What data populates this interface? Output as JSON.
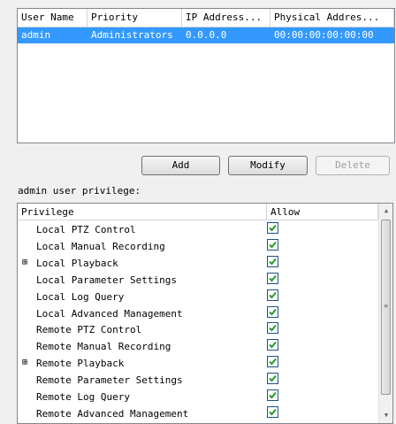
{
  "users_table": {
    "columns": [
      "User Name",
      "Priority",
      "IP Address...",
      "Physical Addres..."
    ],
    "rows": [
      {
        "user_name": "admin",
        "priority": "Administrators",
        "ip": "0.0.0.0",
        "mac": "00:00:00:00:00:00"
      }
    ]
  },
  "buttons": {
    "add": "Add",
    "modify": "Modify",
    "delete": "Delete"
  },
  "privilege_label": "admin user privilege:",
  "privilege_table": {
    "columns": [
      "Privilege",
      "Allow"
    ],
    "rows": [
      {
        "name": "Local PTZ Control",
        "expandable": false,
        "allowed": true
      },
      {
        "name": "Local Manual Recording",
        "expandable": false,
        "allowed": true
      },
      {
        "name": "Local Playback",
        "expandable": true,
        "allowed": true
      },
      {
        "name": "Local Parameter Settings",
        "expandable": false,
        "allowed": true
      },
      {
        "name": "Local Log Query",
        "expandable": false,
        "allowed": true
      },
      {
        "name": "Local Advanced Management",
        "expandable": false,
        "allowed": true
      },
      {
        "name": "Remote PTZ Control",
        "expandable": false,
        "allowed": true
      },
      {
        "name": "Remote Manual Recording",
        "expandable": false,
        "allowed": true
      },
      {
        "name": "Remote Playback",
        "expandable": true,
        "allowed": true
      },
      {
        "name": "Remote Parameter Settings",
        "expandable": false,
        "allowed": true
      },
      {
        "name": "Remote Log Query",
        "expandable": false,
        "allowed": true
      },
      {
        "name": "Remote Advanced Management",
        "expandable": false,
        "allowed": true
      }
    ]
  },
  "icons": {
    "expander": "⊞",
    "scroll_up": "▲",
    "scroll_down": "▼",
    "grip": "≡"
  },
  "colors": {
    "selection": "#3399ff",
    "check": "#1f9d2f"
  }
}
